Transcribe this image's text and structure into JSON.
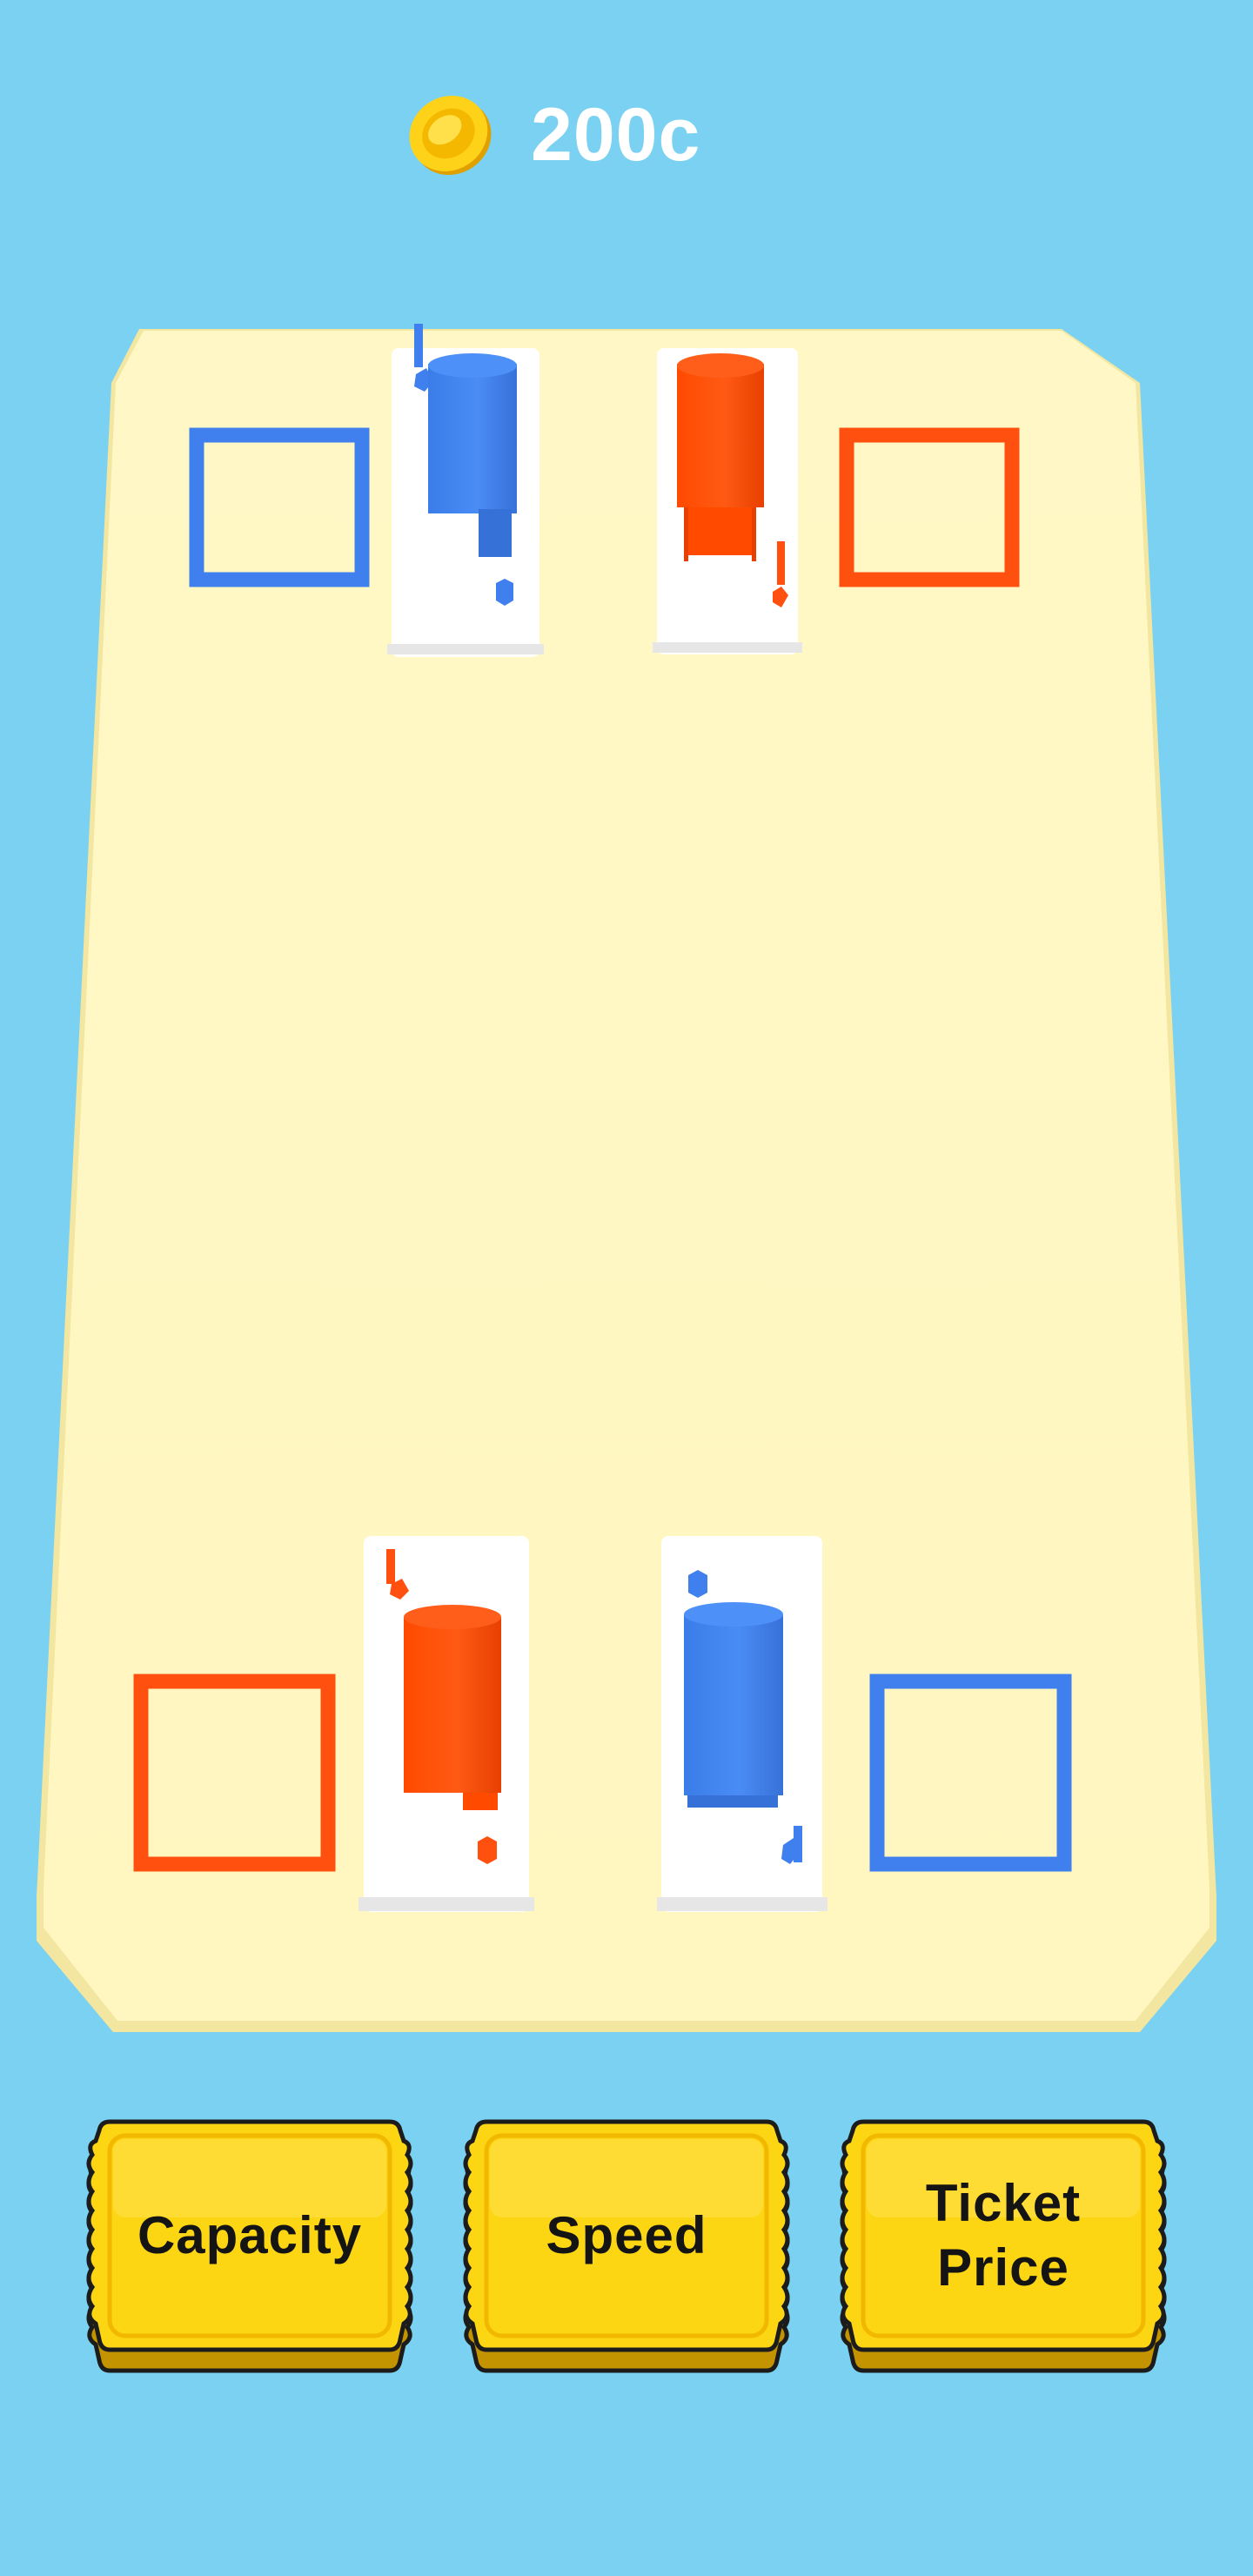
{
  "hud": {
    "coin_icon": "gold-coin-icon",
    "coins": "200c"
  },
  "board": {
    "floor_color": "#fff8c4",
    "zones": [
      {
        "name": "top-left",
        "color": "blue",
        "hex": "#3f80ee"
      },
      {
        "name": "top-right",
        "color": "red",
        "hex": "#ff5010"
      },
      {
        "name": "bottom-left",
        "color": "red",
        "hex": "#ff5010"
      },
      {
        "name": "bottom-right",
        "color": "blue",
        "hex": "#3f80ee"
      }
    ]
  },
  "upgrades": {
    "capacity_label": "Capacity",
    "speed_label": "Speed",
    "ticket_price_label": "Ticket\nPrice",
    "ticket_color": "#fcd513"
  }
}
